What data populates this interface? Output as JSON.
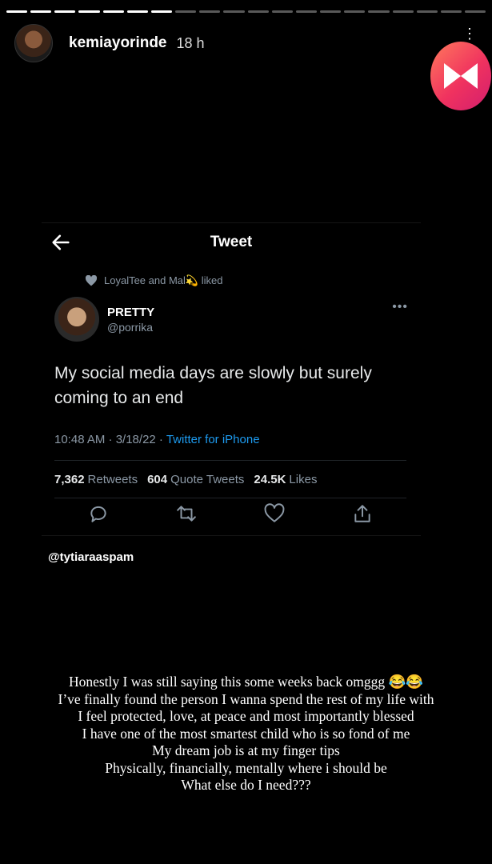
{
  "story": {
    "segments_total": 20,
    "segments_viewed": 7,
    "username": "kemiayorinde",
    "time_ago": "18 h",
    "more_icon": "⋮"
  },
  "tweet": {
    "header_title": "Tweet",
    "liked_by": "LoyalTee and Mal💫 liked",
    "display_name": "PRETTY",
    "handle": "@porrika",
    "more": "•••",
    "text": "My social media days are slowly but surely coming to an end",
    "time": "10:48 AM · 3/18/22 · ",
    "source": "Twitter for iPhone",
    "retweets_count": "7,362",
    "retweets_label": "Retweets",
    "quotes_count": "604",
    "quotes_label": "Quote Tweets",
    "likes_count": "24.5K",
    "likes_label": "Likes"
  },
  "mention": "@tytiaraaspam",
  "caption": [
    "Honestly I was still saying this some weeks back omggg 😂😂",
    "I’ve finally found the person I wanna spend the rest of my life with",
    "I feel protected, love, at peace and most importantly blessed",
    "I have one of the most smartest child who is so fond of me",
    "My dream job is at my finger tips",
    "Physically, financially, mentally where i should be",
    "What else do I need???"
  ]
}
